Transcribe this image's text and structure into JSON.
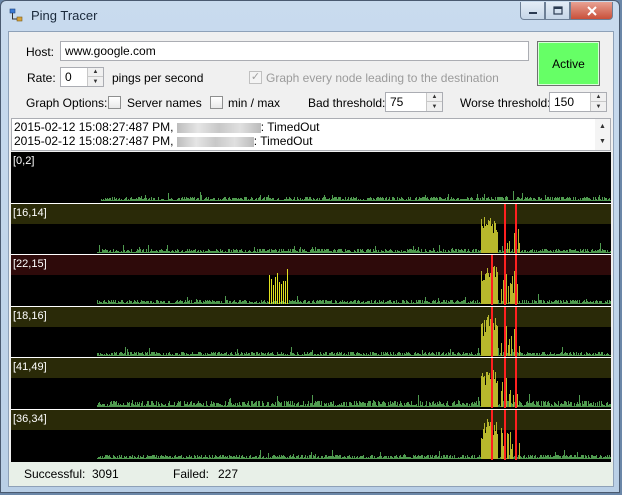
{
  "window": {
    "title": "Ping Tracer"
  },
  "form": {
    "host_label": "Host:",
    "host_value": "www.google.com",
    "rate_label": "Rate:",
    "rate_value": "0",
    "rate_unit": "pings per second",
    "graph_every_node_label": "Graph every node leading to the destination",
    "graph_every_node_checked": true,
    "graph_options_label": "Graph Options:",
    "server_names_label": "Server names",
    "server_names_checked": false,
    "minmax_label": "min / max",
    "minmax_checked": false,
    "bad_threshold_label": "Bad threshold:",
    "bad_threshold_value": "75",
    "worse_threshold_label": "Worse threshold:",
    "worse_threshold_value": "150",
    "active_button_label": "Active",
    "active_button_color": "#66ff66"
  },
  "log": {
    "lines": [
      {
        "timestamp": "2015-02-12 15:08:27:487 PM,",
        "status": ": TimedOut"
      },
      {
        "timestamp": "2015-02-12 15:08:27:487 PM,",
        "status": ": TimedOut"
      }
    ]
  },
  "graphs": [
    {
      "label": "[0,2]",
      "state": "normal"
    },
    {
      "label": "[16,14]",
      "state": "bad"
    },
    {
      "label": "[22,15]",
      "state": "worse"
    },
    {
      "label": "[18,16]",
      "state": "bad"
    },
    {
      "label": "[41,49]",
      "state": "bad"
    },
    {
      "label": "[36,34]",
      "state": "bad"
    }
  ],
  "status_bar": {
    "successful_label": "Successful:",
    "successful_value": "3091",
    "failed_label": "Failed:",
    "failed_value": "227"
  },
  "colors": {
    "graph_background": "#000000",
    "bad_band": "#2a2a08",
    "worse_band": "#2e0a0a",
    "ping_bar": "#4f9a4f",
    "bad_spike": "#b8b82c",
    "worse_spike": "#e0e020",
    "timeout_line": "#ff2020"
  }
}
